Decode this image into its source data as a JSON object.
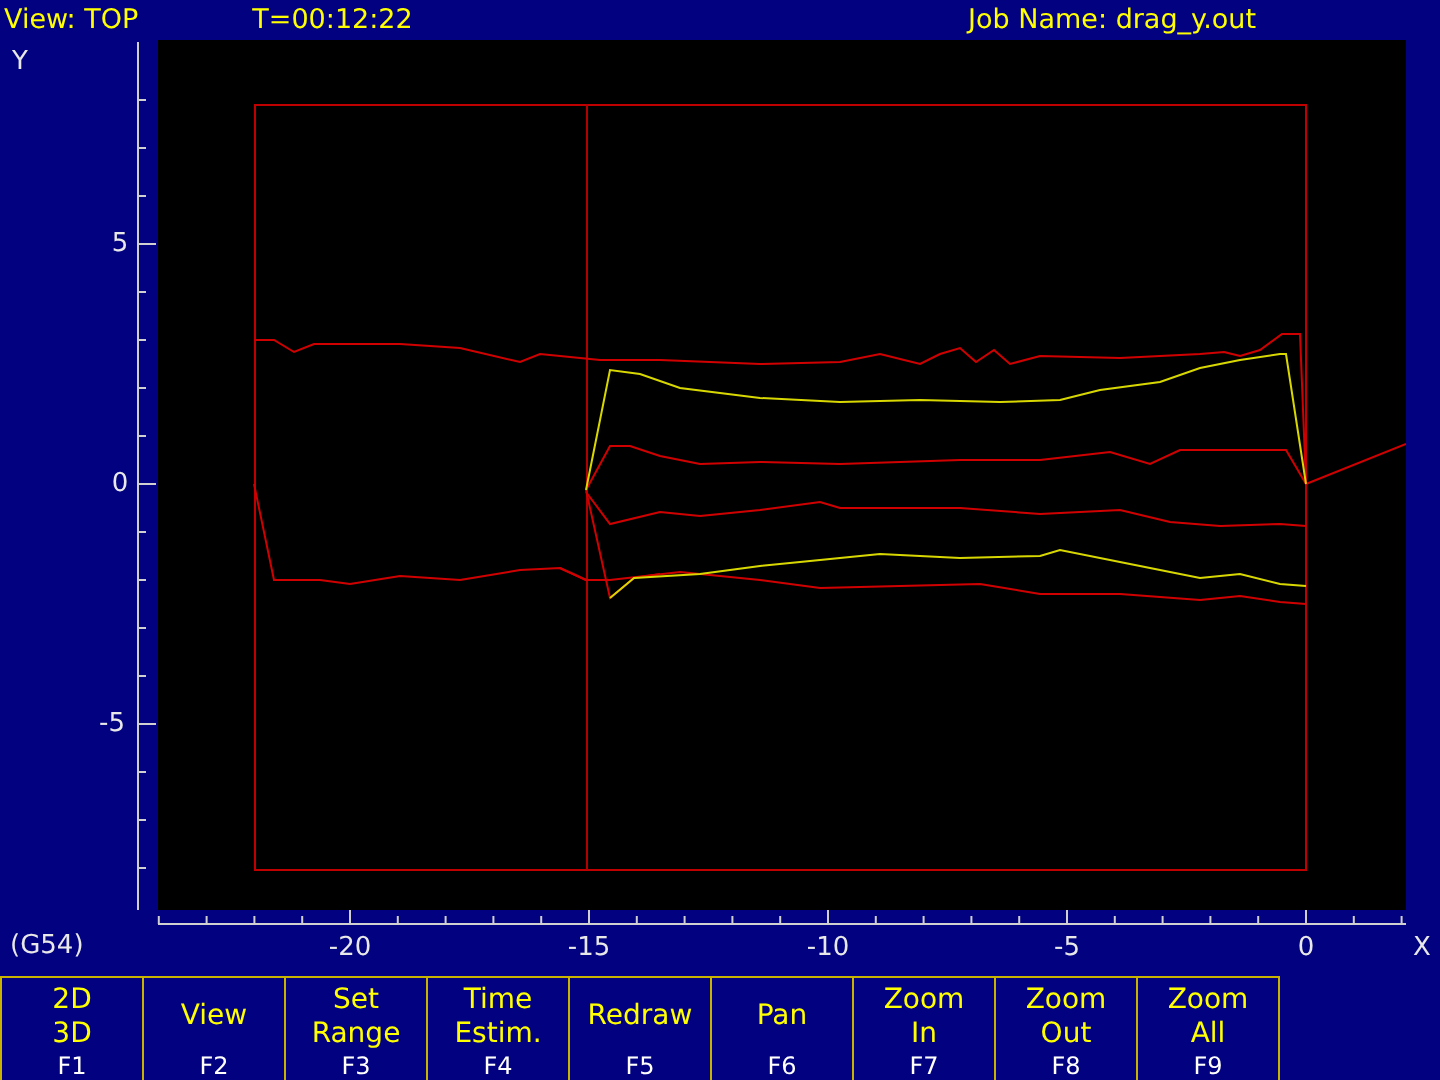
{
  "status_bar": {
    "view": "View: TOP",
    "time": "T=00:12:22",
    "job": "Job Name: drag_y.out"
  },
  "y_axis": {
    "label": "Y",
    "ticks": [
      "5",
      "0",
      "-5"
    ]
  },
  "x_axis": {
    "label": "X",
    "ticks": [
      "-20",
      "-15",
      "-10",
      "-5",
      "0"
    ]
  },
  "coordinate_system": "(G54)",
  "function_keys": [
    {
      "label": [
        "2D",
        "3D"
      ],
      "key": "F1"
    },
    {
      "label": [
        "View"
      ],
      "key": "F2"
    },
    {
      "label": [
        "Set",
        "Range"
      ],
      "key": "F3"
    },
    {
      "label": [
        "Time",
        "Estim."
      ],
      "key": "F4"
    },
    {
      "label": [
        "Redraw"
      ],
      "key": "F5"
    },
    {
      "label": [
        "Pan"
      ],
      "key": "F6"
    },
    {
      "label": [
        "Zoom",
        "In"
      ],
      "key": "F7"
    },
    {
      "label": [
        "Zoom",
        "Out"
      ],
      "key": "F8"
    },
    {
      "label": [
        "Zoom",
        "All"
      ],
      "key": "F9"
    }
  ]
}
